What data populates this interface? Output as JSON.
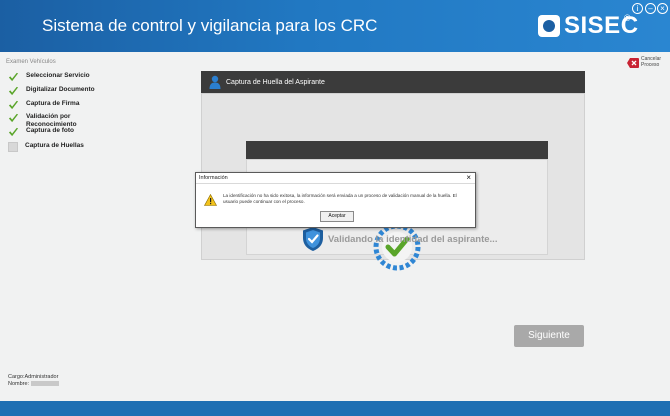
{
  "header": {
    "title": "Sistema de control y vigilancia para los CRC",
    "logo_text": "SISEC",
    "logo_reg": "®",
    "info_symbol": "i",
    "minimize_symbol": "–",
    "close_symbol": "×"
  },
  "sidebar": {
    "title": "Examen Vehículos",
    "steps": [
      {
        "label": "Seleccionar Servicio",
        "status": "done"
      },
      {
        "label": "Digitalizar Documento",
        "status": "done"
      },
      {
        "label": "Captura de Firma",
        "status": "done"
      },
      {
        "label": "Validación por Reconocimiento",
        "status": "done"
      },
      {
        "label": "Captura de foto",
        "status": "done"
      },
      {
        "label": "Captura de Huellas",
        "status": "pending"
      }
    ]
  },
  "cancel": {
    "label": "Cancelar Proceso"
  },
  "panel": {
    "title": "Captura de Huella del Aspirante"
  },
  "status": {
    "validating_text": "Validando la identidad del aspirante..."
  },
  "next_button": {
    "label": "Siguiente"
  },
  "user": {
    "cargo_label": "Cargo:",
    "cargo_value": "Administrador",
    "nombre_label": "Nombre:"
  },
  "dialog": {
    "title": "Información",
    "close_symbol": "×",
    "message": "La identificación no ha sido exitosa, la información será enviada a un proceso de validación manual de la huella. El usuario puede continuar con el proceso.",
    "ok_label": "Aceptar"
  },
  "colors": {
    "brand_blue": "#1f6fb3",
    "check_green": "#5aa52a",
    "dark_bar": "#3b3b3b",
    "warning_yellow": "#f2c21b"
  }
}
